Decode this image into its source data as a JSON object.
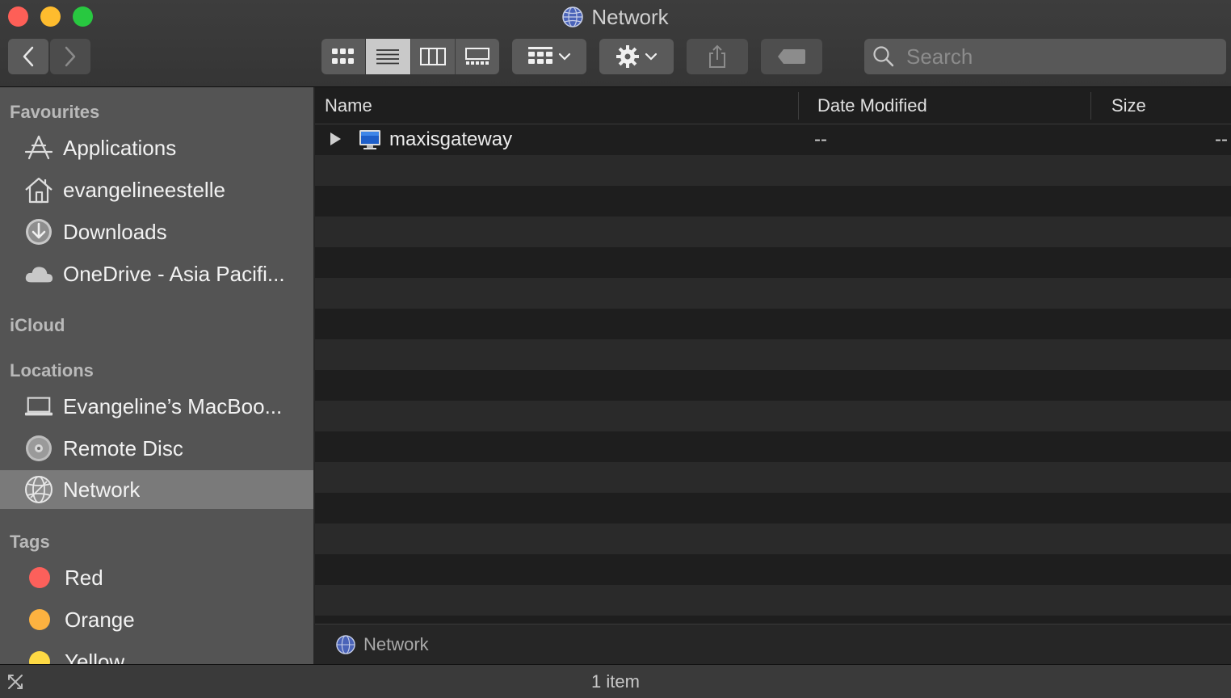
{
  "window": {
    "title": "Network"
  },
  "toolbar": {
    "search_placeholder": "Search",
    "view_modes": [
      "icon",
      "list",
      "column",
      "gallery"
    ],
    "active_view": "list"
  },
  "sidebar": {
    "sections": {
      "favourites": "Favourites",
      "icloud": "iCloud",
      "locations": "Locations",
      "tags": "Tags"
    },
    "favourites": [
      {
        "label": "Applications",
        "icon": "applications-icon"
      },
      {
        "label": "evangelineestelle",
        "icon": "home-icon"
      },
      {
        "label": "Downloads",
        "icon": "downloads-icon"
      },
      {
        "label": "OneDrive - Asia Pacifi...",
        "icon": "cloud-icon"
      }
    ],
    "locations": [
      {
        "label": "Evangeline’s MacBoo...",
        "icon": "laptop-icon"
      },
      {
        "label": "Remote Disc",
        "icon": "disc-icon"
      },
      {
        "label": "Network",
        "icon": "network-globe-icon",
        "selected": true
      }
    ],
    "tags": [
      {
        "label": "Red",
        "color": "#fc605b"
      },
      {
        "label": "Orange",
        "color": "#fdb240"
      },
      {
        "label": "Yellow",
        "color": "#fdd944"
      }
    ]
  },
  "columns": {
    "name": "Name",
    "date_modified": "Date Modified",
    "size": "Size"
  },
  "files": [
    {
      "name": "maxisgateway",
      "date_modified": "--",
      "size": "--",
      "icon": "computer-icon"
    }
  ],
  "pathbar": {
    "label": "Network"
  },
  "status": {
    "text": "1 item"
  },
  "colors": {
    "background": "#1e1e1e",
    "sidebar": "#545454",
    "selected": "#7a7a7a"
  }
}
